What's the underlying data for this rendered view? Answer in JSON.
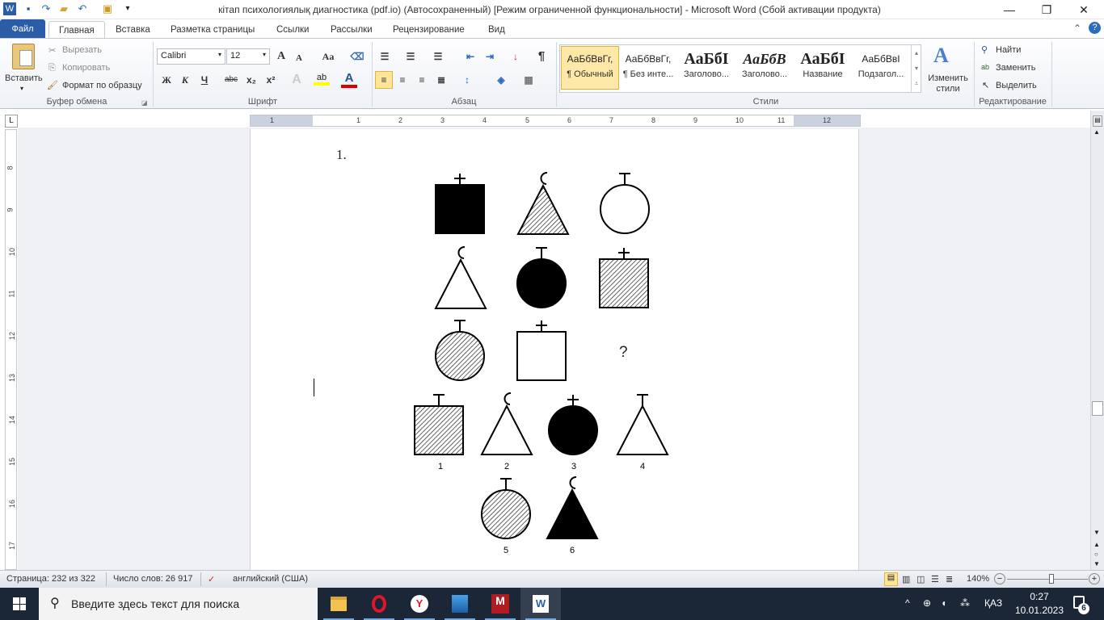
{
  "window": {
    "title": "кітап психологиялық диагностика (pdf.io) (Автосохраненный) [Режим ограниченной функциональности]  -  Microsoft Word (Сбой активации продукта)",
    "minimize_icon": "minimize-icon",
    "maximize_icon": "restore-icon",
    "close_icon": "close-icon"
  },
  "quick_access": [
    "word-logo-icon",
    "save-icon",
    "redo-icon",
    "open-icon",
    "undo-icon",
    "customize-icon"
  ],
  "tabs": [
    {
      "label": "Файл"
    },
    {
      "label": "Главная"
    },
    {
      "label": "Вставка"
    },
    {
      "label": "Разметка страницы"
    },
    {
      "label": "Ссылки"
    },
    {
      "label": "Рассылки"
    },
    {
      "label": "Рецензирование"
    },
    {
      "label": "Вид"
    }
  ],
  "ribbon": {
    "clipboard": {
      "label": "Буфер обмена",
      "paste": "Вставить",
      "cut": "Вырезать",
      "copy": "Копировать",
      "format_painter": "Формат по образцу"
    },
    "font": {
      "label": "Шрифт",
      "font_name": "Calibri",
      "font_size": "12",
      "bold": "Ж",
      "italic": "К",
      "underline": "Ч",
      "strike": "abc",
      "sub": "x₂",
      "sup": "x²",
      "change_case": "Aa",
      "grow": "A",
      "shrink": "A",
      "text_effects": "A",
      "font_color": "A",
      "highlight_color": "#ffff00",
      "font_color_value": "#e00000"
    },
    "paragraph": {
      "label": "Абзац",
      "pilcrow": "¶"
    },
    "styles": {
      "label": "Стили",
      "items": [
        {
          "preview": "АаБбВвГг,",
          "name": "¶ Обычный",
          "selected": true
        },
        {
          "preview": "АаБбВвГг,",
          "name": "¶ Без инте..."
        },
        {
          "preview": "АаБбI",
          "name": "Заголово..."
        },
        {
          "preview": "АаБбВ",
          "name": "Заголово..."
        },
        {
          "preview": "АаБбI",
          "name": "Название"
        },
        {
          "preview": "АаБбВвI",
          "name": "Подзагол..."
        }
      ],
      "change_styles": "Изменить стили"
    },
    "editing": {
      "label": "Редактирование",
      "find": "Найти",
      "replace": "Заменить",
      "select": "Выделить"
    }
  },
  "ruler": {
    "h_numbers": [
      "1",
      "1",
      "2",
      "3",
      "4",
      "5",
      "6",
      "7",
      "8",
      "9",
      "10",
      "11",
      "12"
    ],
    "v_numbers": [
      "8",
      "9",
      "10",
      "11",
      "12",
      "13",
      "14",
      "15",
      "16",
      "17"
    ]
  },
  "document": {
    "item_number": "1.",
    "question_mark": "?",
    "matrix": [
      {
        "shape": "square",
        "fill": "solid",
        "topper": "cross"
      },
      {
        "shape": "triangle",
        "fill": "hatched",
        "topper": "crescent"
      },
      {
        "shape": "circle",
        "fill": "empty",
        "topper": "t-bar"
      },
      {
        "shape": "triangle",
        "fill": "empty",
        "topper": "crescent"
      },
      {
        "shape": "circle",
        "fill": "solid",
        "topper": "t-bar"
      },
      {
        "shape": "square",
        "fill": "hatched",
        "topper": "cross"
      },
      {
        "shape": "circle",
        "fill": "hatched",
        "topper": "t-bar"
      },
      {
        "shape": "square",
        "fill": "empty",
        "topper": "cross"
      }
    ],
    "options": [
      {
        "label": "1",
        "shape": "square",
        "fill": "hatched",
        "topper": "t-bar"
      },
      {
        "label": "2",
        "shape": "triangle",
        "fill": "empty",
        "topper": "crescent"
      },
      {
        "label": "3",
        "shape": "circle",
        "fill": "solid",
        "topper": "cross"
      },
      {
        "label": "4",
        "shape": "triangle",
        "fill": "empty",
        "topper": "t-bar"
      },
      {
        "label": "5",
        "shape": "circle",
        "fill": "hatched",
        "topper": "t-bar"
      },
      {
        "label": "6",
        "shape": "triangle",
        "fill": "solid",
        "topper": "crescent"
      }
    ]
  },
  "status": {
    "page": "Страница: 232 из 322",
    "words": "Число слов: 26 917",
    "language": "английский (США)",
    "zoom": "140%",
    "zoom_percent": 140
  },
  "taskbar": {
    "search_placeholder": "Введите здесь текст для поиска",
    "apps": [
      "file-explorer-icon",
      "opera-icon",
      "yandex-browser-icon",
      "photos-icon",
      "pdf-app-icon",
      "word-icon"
    ],
    "language": "ҚАЗ",
    "time": "0:27",
    "date": "10.01.2023",
    "notifications": "6"
  }
}
